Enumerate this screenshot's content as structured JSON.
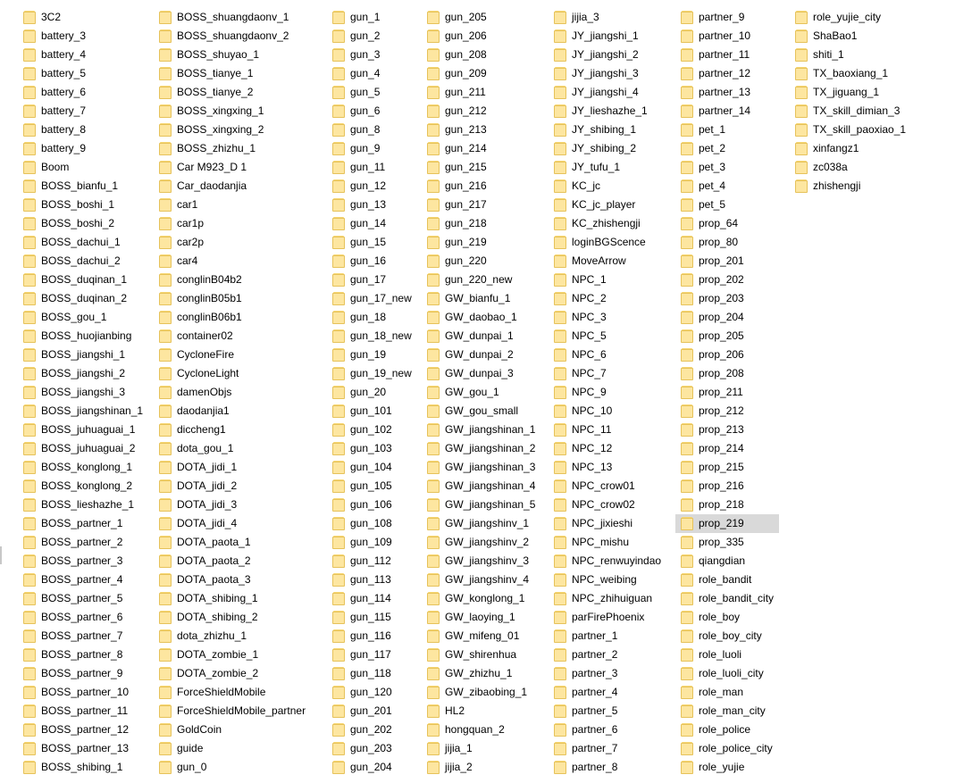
{
  "selected_item": "prop_219",
  "columns": [
    [
      "3C2",
      "battery_3",
      "battery_4",
      "battery_5",
      "battery_6",
      "battery_7",
      "battery_8",
      "battery_9",
      "Boom",
      "BOSS_bianfu_1",
      "BOSS_boshi_1",
      "BOSS_boshi_2",
      "BOSS_dachui_1",
      "BOSS_dachui_2",
      "BOSS_duqinan_1",
      "BOSS_duqinan_2",
      "BOSS_gou_1",
      "BOSS_huojianbing",
      "BOSS_jiangshi_1",
      "BOSS_jiangshi_2",
      "BOSS_jiangshi_3",
      "BOSS_jiangshinan_1",
      "BOSS_juhuaguai_1",
      "BOSS_juhuaguai_2",
      "BOSS_konglong_1",
      "BOSS_konglong_2",
      "BOSS_lieshazhe_1",
      "BOSS_partner_1",
      "BOSS_partner_2",
      "BOSS_partner_3",
      "BOSS_partner_4",
      "BOSS_partner_5",
      "BOSS_partner_6",
      "BOSS_partner_7",
      "BOSS_partner_8",
      "BOSS_partner_9",
      "BOSS_partner_10",
      "BOSS_partner_11",
      "BOSS_partner_12",
      "BOSS_partner_13",
      "BOSS_shibing_1"
    ],
    [
      "BOSS_shuangdaonv_1",
      "BOSS_shuangdaonv_2",
      "BOSS_shuyao_1",
      "BOSS_tianye_1",
      "BOSS_tianye_2",
      "BOSS_xingxing_1",
      "BOSS_xingxing_2",
      "BOSS_zhizhu_1",
      "Car M923_D 1",
      "Car_daodanjia",
      "car1",
      "car1p",
      "car2p",
      "car4",
      "conglinB04b2",
      "conglinB05b1",
      "conglinB06b1",
      "container02",
      "CycloneFire",
      "CycloneLight",
      "damenObjs",
      "daodanjia1",
      "diccheng1",
      "dota_gou_1",
      "DOTA_jidi_1",
      "DOTA_jidi_2",
      "DOTA_jidi_3",
      "DOTA_jidi_4",
      "DOTA_paota_1",
      "DOTA_paota_2",
      "DOTA_paota_3",
      "DOTA_shibing_1",
      "DOTA_shibing_2",
      "dota_zhizhu_1",
      "DOTA_zombie_1",
      "DOTA_zombie_2",
      "ForceShieldMobile",
      "ForceShieldMobile_partner",
      "GoldCoin",
      "guide",
      "gun_0"
    ],
    [
      "gun_1",
      "gun_2",
      "gun_3",
      "gun_4",
      "gun_5",
      "gun_6",
      "gun_8",
      "gun_9",
      "gun_11",
      "gun_12",
      "gun_13",
      "gun_14",
      "gun_15",
      "gun_16",
      "gun_17",
      "gun_17_new",
      "gun_18",
      "gun_18_new",
      "gun_19",
      "gun_19_new",
      "gun_20",
      "gun_101",
      "gun_102",
      "gun_103",
      "gun_104",
      "gun_105",
      "gun_106",
      "gun_108",
      "gun_109",
      "gun_112",
      "gun_113",
      "gun_114",
      "gun_115",
      "gun_116",
      "gun_117",
      "gun_118",
      "gun_120",
      "gun_201",
      "gun_202",
      "gun_203",
      "gun_204"
    ],
    [
      "gun_205",
      "gun_206",
      "gun_208",
      "gun_209",
      "gun_211",
      "gun_212",
      "gun_213",
      "gun_214",
      "gun_215",
      "gun_216",
      "gun_217",
      "gun_218",
      "gun_219",
      "gun_220",
      "gun_220_new",
      "GW_bianfu_1",
      "GW_daobao_1",
      "GW_dunpai_1",
      "GW_dunpai_2",
      "GW_dunpai_3",
      "GW_gou_1",
      "GW_gou_small",
      "GW_jiangshinan_1",
      "GW_jiangshinan_2",
      "GW_jiangshinan_3",
      "GW_jiangshinan_4",
      "GW_jiangshinan_5",
      "GW_jiangshinv_1",
      "GW_jiangshinv_2",
      "GW_jiangshinv_3",
      "GW_jiangshinv_4",
      "GW_konglong_1",
      "GW_laoying_1",
      "GW_mifeng_01",
      "GW_shirenhua",
      "GW_zhizhu_1",
      "GW_zibaobing_1",
      "HL2",
      "hongquan_2",
      "jijia_1",
      "jijia_2"
    ],
    [
      "jijia_3",
      "JY_jiangshi_1",
      "JY_jiangshi_2",
      "JY_jiangshi_3",
      "JY_jiangshi_4",
      "JY_lieshazhe_1",
      "JY_shibing_1",
      "JY_shibing_2",
      "JY_tufu_1",
      "KC_jc",
      "KC_jc_player",
      "KC_zhishengji",
      "loginBGScence",
      "MoveArrow",
      "NPC_1",
      "NPC_2",
      "NPC_3",
      "NPC_5",
      "NPC_6",
      "NPC_7",
      "NPC_9",
      "NPC_10",
      "NPC_11",
      "NPC_12",
      "NPC_13",
      "NPC_crow01",
      "NPC_crow02",
      "NPC_jixieshi",
      "NPC_mishu",
      "NPC_renwuyindao",
      "NPC_weibing",
      "NPC_zhihuiguan",
      "parFirePhoenix",
      "partner_1",
      "partner_2",
      "partner_3",
      "partner_4",
      "partner_5",
      "partner_6",
      "partner_7",
      "partner_8"
    ],
    [
      "partner_9",
      "partner_10",
      "partner_11",
      "partner_12",
      "partner_13",
      "partner_14",
      "pet_1",
      "pet_2",
      "pet_3",
      "pet_4",
      "pet_5",
      "prop_64",
      "prop_80",
      "prop_201",
      "prop_202",
      "prop_203",
      "prop_204",
      "prop_205",
      "prop_206",
      "prop_208",
      "prop_211",
      "prop_212",
      "prop_213",
      "prop_214",
      "prop_215",
      "prop_216",
      "prop_218",
      "prop_219",
      "prop_335",
      "qiangdian",
      "role_bandit",
      "role_bandit_city",
      "role_boy",
      "role_boy_city",
      "role_luoli",
      "role_luoli_city",
      "role_man",
      "role_man_city",
      "role_police",
      "role_police_city",
      "role_yujie"
    ],
    [
      "role_yujie_city",
      "ShaBao1",
      "shiti_1",
      "TX_baoxiang_1",
      "TX_jiguang_1",
      "TX_skill_dimian_3",
      "TX_skill_paoxiao_1",
      "xinfangz1",
      "zc038a",
      "zhishengji"
    ]
  ]
}
